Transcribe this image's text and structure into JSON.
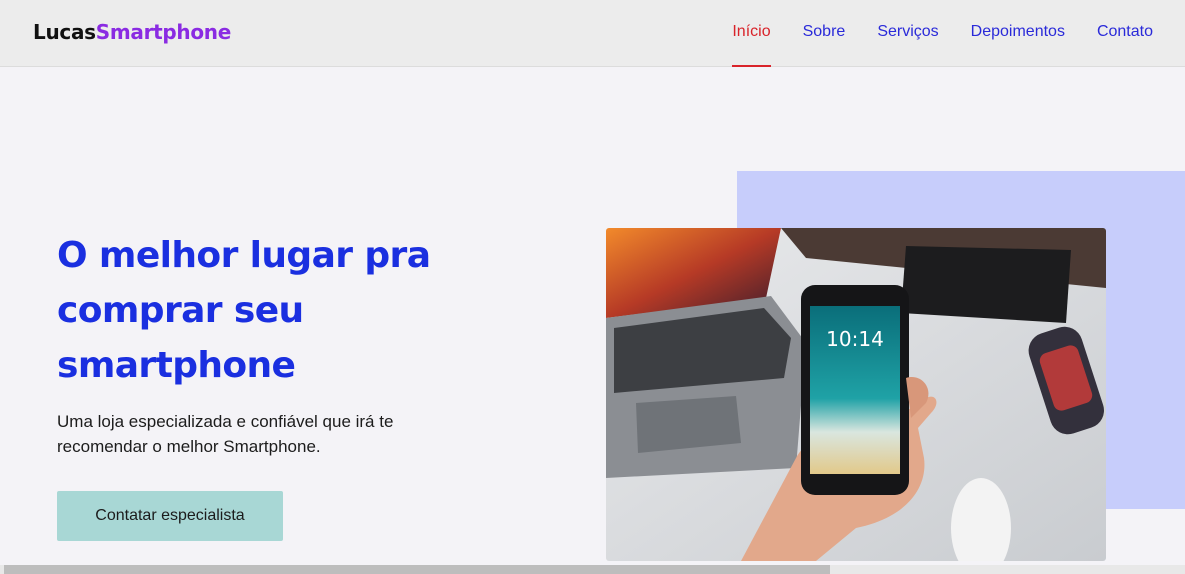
{
  "header": {
    "logo": {
      "part1": "Lucas",
      "part2": "Smartphone"
    },
    "nav": [
      {
        "label": "Início",
        "active": true
      },
      {
        "label": "Sobre",
        "active": false
      },
      {
        "label": "Serviços",
        "active": false
      },
      {
        "label": "Depoimentos",
        "active": false
      },
      {
        "label": "Contato",
        "active": false
      }
    ]
  },
  "hero": {
    "title_lines": [
      "O melhor lugar pra",
      "comprar seu",
      "smartphone"
    ],
    "subtitle": "Uma loja especializada e confiável que irá te recomendar o melhor Smartphone.",
    "cta_label": "Contatar especialista",
    "image": {
      "phone_time": "10:14"
    }
  },
  "colors": {
    "accent_blue": "#1a2fe0",
    "active_red": "#d9232a",
    "logo_purple": "#8a2be2",
    "cta_teal": "#a8d7d5",
    "backdrop_lavender": "#c7cdfb"
  }
}
